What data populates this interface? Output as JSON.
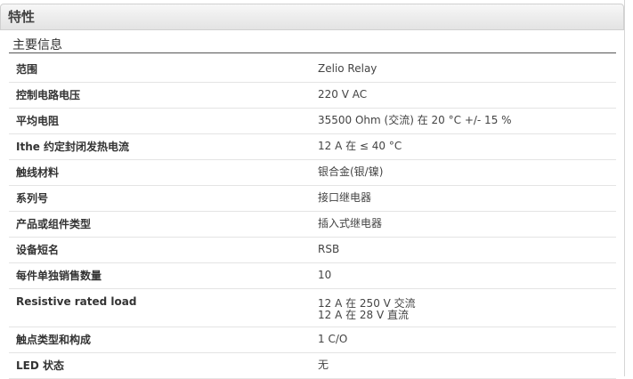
{
  "panel": {
    "title": "特性"
  },
  "section": {
    "title": "主要信息"
  },
  "rows": [
    {
      "label": "范围",
      "value_lines": [
        "Zelio Relay"
      ]
    },
    {
      "label": "控制电路电压",
      "value_lines": [
        "220 V AC"
      ]
    },
    {
      "label": "平均电阻",
      "value_lines": [
        "35500 Ohm (交流) 在 20 °C +/- 15 %"
      ]
    },
    {
      "label": "Ithe 约定封闭发热电流",
      "value_lines": [
        "12 A 在 ≤ 40 °C"
      ]
    },
    {
      "label": "触线材料",
      "value_lines": [
        "银合金(银/镍)"
      ]
    },
    {
      "label": "系列号",
      "value_lines": [
        "接口继电器"
      ]
    },
    {
      "label": "产品或组件类型",
      "value_lines": [
        "插入式继电器"
      ]
    },
    {
      "label": "设备短名",
      "value_lines": [
        "RSB"
      ]
    },
    {
      "label": "每件单独销售数量",
      "value_lines": [
        "10"
      ]
    },
    {
      "label": "Resistive rated load",
      "value_lines": [
        "12 A 在 250 V 交流",
        "12 A 在 28 V 直流"
      ]
    },
    {
      "label": "触点类型和构成",
      "value_lines": [
        "1 C/O"
      ]
    },
    {
      "label": "LED 状态",
      "value_lines": [
        "无"
      ]
    }
  ]
}
